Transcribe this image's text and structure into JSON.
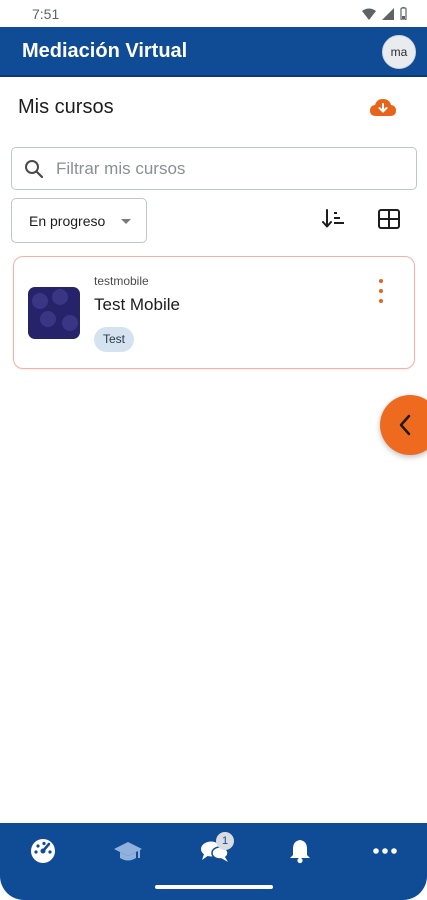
{
  "status_bar": {
    "time": "7:51"
  },
  "header": {
    "title": "Mediación Virtual",
    "avatar_initials": "ma"
  },
  "page": {
    "title": "Mis cursos"
  },
  "search": {
    "placeholder": "Filtrar mis cursos",
    "value": ""
  },
  "filter": {
    "selected": "En progreso"
  },
  "courses": [
    {
      "category": "testmobile",
      "name": "Test Mobile",
      "tag": "Test"
    }
  ],
  "bottom_nav": {
    "items": [
      {
        "icon": "dashboard-icon"
      },
      {
        "icon": "graduation-cap-icon"
      },
      {
        "icon": "messages-icon",
        "badge": "1"
      },
      {
        "icon": "bell-icon"
      },
      {
        "icon": "more-icon"
      }
    ]
  },
  "colors": {
    "primary": "#0f4c95",
    "accent": "#ee6a1f",
    "card_border": "#f2b3a6"
  }
}
